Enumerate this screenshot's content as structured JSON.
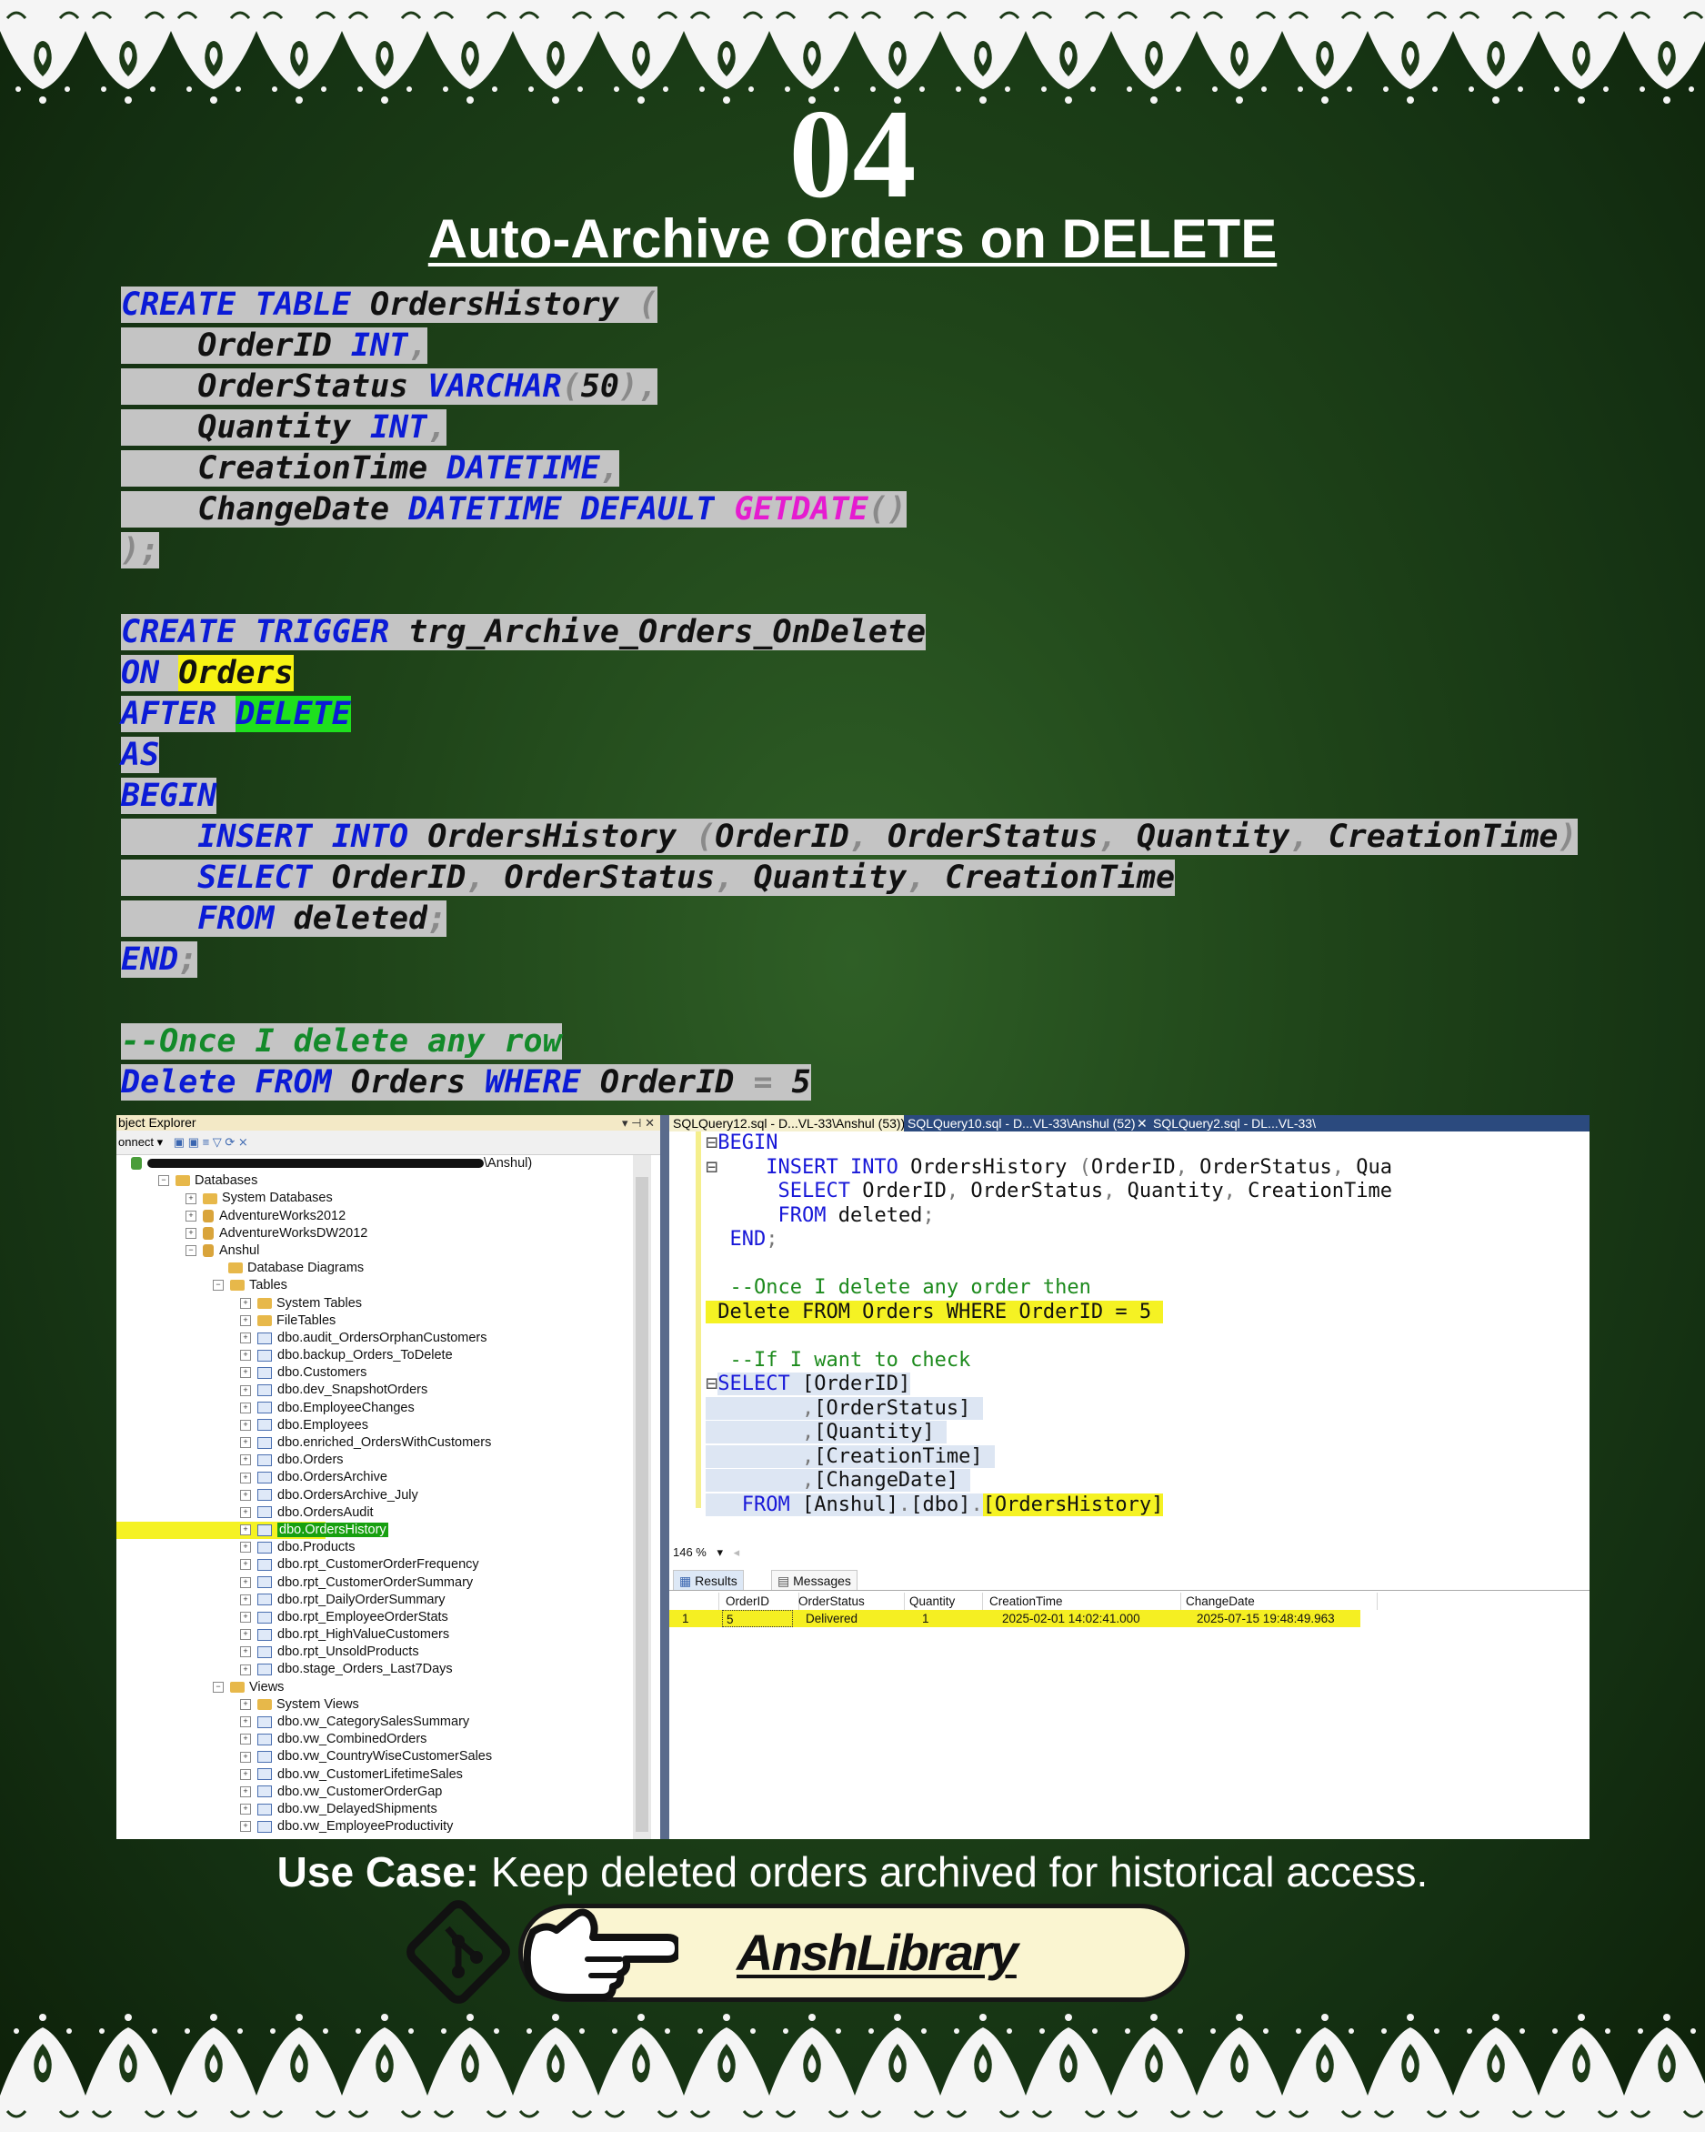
{
  "slide": {
    "number": "04",
    "title": "Auto-Archive Orders on DELETE",
    "use_case_label": "Use Case:",
    "use_case_text": " Keep deleted orders archived for historical access.",
    "brand": "AnshLibrary"
  },
  "code": {
    "create_table": [
      "CREATE",
      "TABLE",
      "OrdersHistory",
      "(",
      "OrderID",
      "INT",
      ",",
      "OrderStatus",
      "VARCHAR",
      "(",
      "50",
      ")",
      ",",
      "Quantity",
      "INT",
      ",",
      "CreationTime",
      "DATETIME",
      ",",
      "ChangeDate",
      "DATETIME",
      "DEFAULT",
      "GETDATE",
      "()",
      ");"
    ],
    "create_trigger": [
      "CREATE",
      "TRIGGER",
      "trg_Archive_Orders_OnDelete",
      "ON",
      "Orders",
      "AFTER",
      "DELETE",
      "AS",
      "BEGIN",
      "INSERT",
      "INTO",
      "OrdersHistory",
      "(",
      "OrderID",
      ",",
      "OrderStatus",
      ",",
      "Quantity",
      ",",
      "CreationTime",
      ")",
      "SELECT",
      "OrderID",
      ",",
      "OrderStatus",
      ",",
      "Quantity",
      ",",
      "CreationTime",
      "FROM",
      "deleted",
      ";",
      "END",
      ";"
    ],
    "comment": "--Once I delete any row",
    "delete_stmt": [
      "Delete",
      "FROM",
      "Orders",
      "WHERE",
      "OrderID",
      "=",
      "5"
    ]
  },
  "object_explorer": {
    "title": "bject Explorer",
    "toolbar": "onnect ▾",
    "server": "\\Anshul)",
    "nodes": [
      "Databases",
      "System Databases",
      "AdventureWorks2012",
      "AdventureWorksDW2012",
      "Anshul",
      "Database Diagrams",
      "Tables",
      "System Tables",
      "FileTables",
      "dbo.audit_OrdersOrphanCustomers",
      "dbo.backup_Orders_ToDelete",
      "dbo.Customers",
      "dbo.dev_SnapshotOrders",
      "dbo.EmployeeChanges",
      "dbo.Employees",
      "dbo.enriched_OrdersWithCustomers",
      "dbo.Orders",
      "dbo.OrdersArchive",
      "dbo.OrdersArchive_July",
      "dbo.OrdersAudit",
      "dbo.OrdersHistory",
      "dbo.Products",
      "dbo.rpt_CustomerOrderFrequency",
      "dbo.rpt_CustomerOrderSummary",
      "dbo.rpt_DailyOrderSummary",
      "dbo.rpt_EmployeeOrderStats",
      "dbo.rpt_HighValueCustomers",
      "dbo.rpt_UnsoldProducts",
      "dbo.stage_Orders_Last7Days",
      "Views",
      "System Views",
      "dbo.vw_CategorySalesSummary",
      "dbo.vw_CombinedOrders",
      "dbo.vw_CountryWiseCustomerSales",
      "dbo.vw_CustomerLifetimeSales",
      "dbo.vw_CustomerOrderGap",
      "dbo.vw_DelayedShipments",
      "dbo.vw_EmployeeProductivity"
    ]
  },
  "editor": {
    "tabs": [
      "SQLQuery12.sql - D...VL-33\\Anshul (53))*",
      "SQLQuery10.sql - D...VL-33\\Anshul (52))*",
      "SQLQuery2.sql - DL...VL-33\\"
    ],
    "lines": [
      "BEGIN",
      "    INSERT INTO OrdersHistory (OrderID, OrderStatus, Qua",
      "    SELECT OrderID, OrderStatus, Quantity, CreationTime",
      "    FROM deleted;",
      "END;",
      "",
      "--Once I delete any order then",
      "Delete FROM Orders WHERE OrderID = 5",
      "",
      "--If I want to check",
      "SELECT [OrderID]",
      "      ,[OrderStatus]",
      "      ,[Quantity]",
      "      ,[CreationTime]",
      "      ,[ChangeDate]",
      " FROM [Anshul].[dbo].[OrdersHistory]"
    ],
    "zoom": "146 %",
    "result_tabs": [
      "Results",
      "Messages"
    ],
    "columns": [
      "OrderID",
      "OrderStatus",
      "Quantity",
      "CreationTime",
      "ChangeDate"
    ],
    "row": [
      "1",
      "5",
      "Delivered",
      "1",
      "2025-02-01 14:02:41.000",
      "2025-07-15 19:48:49.963"
    ]
  },
  "colors": {
    "keyword": "#0b1bd6",
    "identifier_bg": "#c4c4c4",
    "highlight_yellow": "#f7f313",
    "highlight_green": "#1ee01e",
    "function": "#e51bd0",
    "comment": "#138a2a"
  },
  "icons": [
    "git-logo-icon",
    "pointing-hand-icon",
    "paisley-border"
  ]
}
